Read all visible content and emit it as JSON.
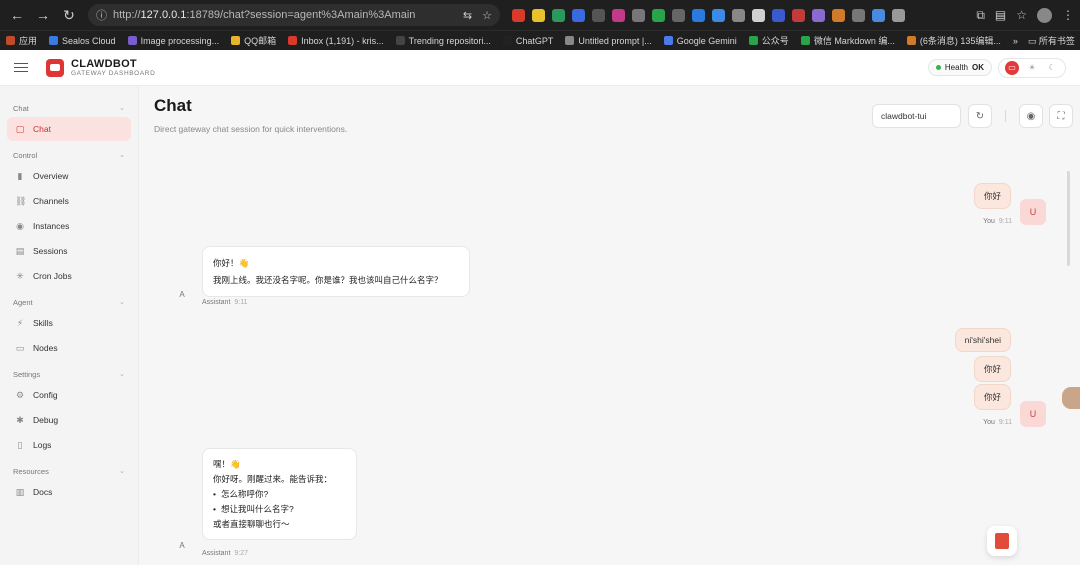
{
  "browser": {
    "url_prefix": "http://",
    "url_host": "127.0.0.1",
    "url_rest": ":18789/chat?session=agent%3Amain%3Amain",
    "bookmarks": [
      {
        "label": "应用",
        "color": "#c24a2a"
      },
      {
        "label": "Sealos Cloud",
        "color": "#3a7be0"
      },
      {
        "label": "Image processing...",
        "color": "#7a5bd0"
      },
      {
        "label": "QQ邮箱",
        "color": "#e8b22a"
      },
      {
        "label": "Inbox (1,191) - kris...",
        "color": "#d93a2a"
      },
      {
        "label": "Trending repositori...",
        "color": "#444444"
      },
      {
        "label": "ChatGPT",
        "color": "#222222"
      },
      {
        "label": "Untitled prompt |...",
        "color": "#888888"
      },
      {
        "label": "Google Gemini",
        "color": "#4a7be8"
      },
      {
        "label": "公众号",
        "color": "#2aa44a"
      },
      {
        "label": "微信 Markdown 编...",
        "color": "#2aa44a"
      },
      {
        "label": "(6条消息) 135编辑...",
        "color": "#d07a2a"
      }
    ],
    "bookmarks_more": "»",
    "all_bookmarks": "所有书签"
  },
  "app": {
    "brand_title": "CLAWDBOT",
    "brand_subtitle": "GATEWAY DASHBOARD",
    "health_label": "Health",
    "health_status": "OK",
    "accent_color": "#e23a3a"
  },
  "sidebar": {
    "sections": [
      {
        "title": "Chat",
        "items": [
          {
            "label": "Chat",
            "icon": "chat-icon",
            "active": true
          }
        ]
      },
      {
        "title": "Control",
        "items": [
          {
            "label": "Overview",
            "icon": "bar-chart-icon"
          },
          {
            "label": "Channels",
            "icon": "link-icon"
          },
          {
            "label": "Instances",
            "icon": "broadcast-icon"
          },
          {
            "label": "Sessions",
            "icon": "document-icon"
          },
          {
            "label": "Cron Jobs",
            "icon": "spinner-icon"
          }
        ]
      },
      {
        "title": "Agent",
        "items": [
          {
            "label": "Skills",
            "icon": "bolt-icon"
          },
          {
            "label": "Nodes",
            "icon": "monitor-icon"
          }
        ]
      },
      {
        "title": "Settings",
        "items": [
          {
            "label": "Config",
            "icon": "gear-icon"
          },
          {
            "label": "Debug",
            "icon": "bug-icon"
          },
          {
            "label": "Logs",
            "icon": "file-icon"
          }
        ]
      },
      {
        "title": "Resources",
        "items": [
          {
            "label": "Docs",
            "icon": "book-icon"
          }
        ]
      }
    ]
  },
  "main": {
    "title": "Chat",
    "subtitle": "Direct gateway chat session for quick interventions.",
    "session_value": "clawdbot-tui"
  },
  "messages": [
    {
      "role": "user",
      "lines": [
        "你好"
      ],
      "sender": "You",
      "time": "9:11",
      "avatar": "U"
    },
    {
      "role": "assistant",
      "greeting": "你好！👋",
      "body": [
        "我刚上线。我还没名字呢。你是谁？我也该叫自己什么名字？"
      ],
      "sender": "Assistant",
      "time": "9:11",
      "avatar": "A"
    },
    {
      "role": "user",
      "lines": [
        "ni'shi'shei",
        "你好",
        "你好"
      ],
      "sender": "You",
      "time": "9:11",
      "avatar": "U"
    },
    {
      "role": "assistant",
      "greeting": "嘿！👋",
      "body": [
        "你好呀。刚醒过来。能告诉我："
      ],
      "bullets": [
        "怎么称呼你?",
        "想让我叫什么名字?"
      ],
      "tail": "或者直接聊聊也行～",
      "sender": "Assistant",
      "time": "9:27",
      "avatar": "A"
    }
  ]
}
